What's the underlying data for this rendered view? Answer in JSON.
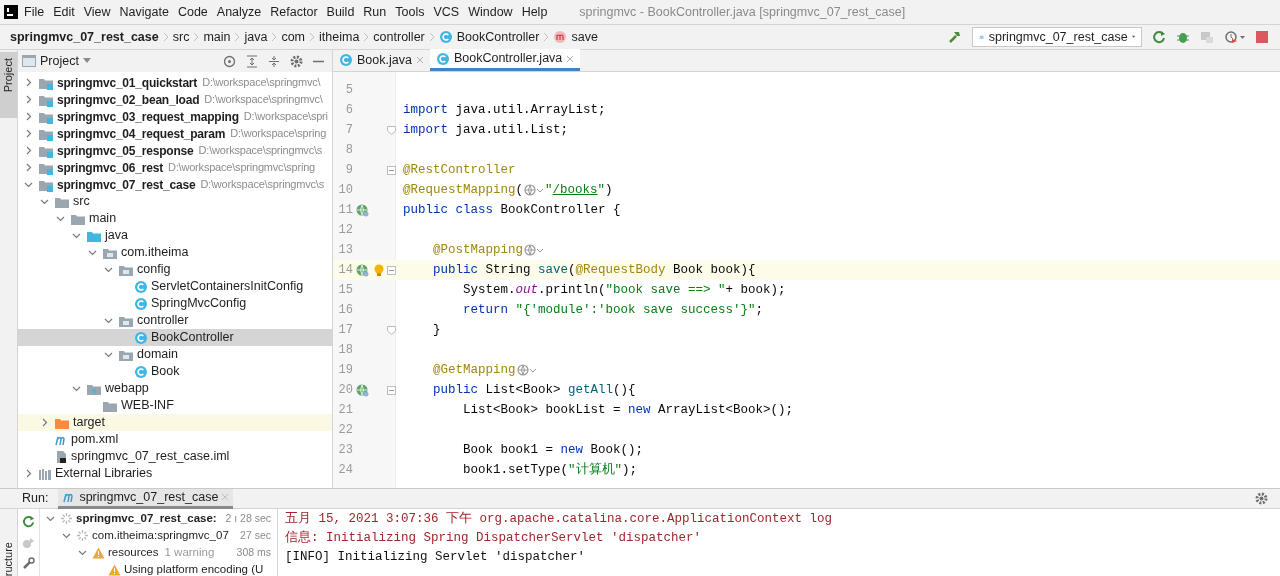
{
  "window": {
    "title": "springmvc - BookController.java [springmvc_07_rest_case]"
  },
  "menu": [
    "File",
    "Edit",
    "View",
    "Navigate",
    "Code",
    "Analyze",
    "Refactor",
    "Build",
    "Run",
    "Tools",
    "VCS",
    "Window",
    "Help"
  ],
  "breadcrumbs": [
    {
      "label": "springmvc_07_rest_case",
      "kind": "project"
    },
    {
      "label": "src",
      "kind": "folder"
    },
    {
      "label": "main",
      "kind": "folder"
    },
    {
      "label": "java",
      "kind": "folder"
    },
    {
      "label": "com",
      "kind": "folder"
    },
    {
      "label": "itheima",
      "kind": "folder"
    },
    {
      "label": "controller",
      "kind": "folder"
    },
    {
      "label": "BookController",
      "kind": "class"
    },
    {
      "label": "save",
      "kind": "method"
    }
  ],
  "run_config": {
    "label": "springmvc_07_rest_case"
  },
  "side_tabs": [
    {
      "label": "Project",
      "selected": true
    },
    {
      "label": "ructure",
      "selected": false
    }
  ],
  "project": {
    "title": "Project",
    "tree": [
      {
        "name": "springmvc_01_quickstart",
        "path": "D:\\workspace\\springmvc\\",
        "kind": "module",
        "expanded": false,
        "selected": false
      },
      {
        "name": "springmvc_02_bean_load",
        "path": "D:\\workspace\\springmvc\\",
        "kind": "module",
        "expanded": false,
        "selected": false
      },
      {
        "name": "springmvc_03_request_mapping",
        "path": "D:\\workspace\\spri",
        "kind": "module",
        "expanded": false,
        "selected": false
      },
      {
        "name": "springmvc_04_request_param",
        "path": "D:\\workspace\\spring",
        "kind": "module",
        "expanded": false,
        "selected": false
      },
      {
        "name": "springmvc_05_response",
        "path": "D:\\workspace\\springmvc\\s",
        "kind": "module",
        "expanded": false,
        "selected": false
      },
      {
        "name": "springmvc_06_rest",
        "path": "D:\\workspace\\springmvc\\spring",
        "kind": "module",
        "expanded": false,
        "selected": false
      },
      {
        "name": "springmvc_07_rest_case",
        "path": "D:\\workspace\\springmvc\\s",
        "kind": "module",
        "expanded": true,
        "selected": false,
        "children": [
          {
            "name": "src",
            "kind": "folder",
            "expanded": true,
            "selected": false,
            "children": [
              {
                "name": "main",
                "kind": "folder",
                "expanded": true,
                "selected": false,
                "children": [
                  {
                    "name": "java",
                    "kind": "source_folder",
                    "expanded": true,
                    "selected": false,
                    "children": [
                      {
                        "name": "com.itheima",
                        "kind": "package",
                        "expanded": true,
                        "selected": false,
                        "children": [
                          {
                            "name": "config",
                            "kind": "package",
                            "expanded": true,
                            "selected": false,
                            "children": [
                              {
                                "name": "ServletContainersInitConfig",
                                "kind": "class",
                                "selected": false
                              },
                              {
                                "name": "SpringMvcConfig",
                                "kind": "class",
                                "selected": false
                              }
                            ]
                          },
                          {
                            "name": "controller",
                            "kind": "package",
                            "expanded": true,
                            "selected": false,
                            "children": [
                              {
                                "name": "BookController",
                                "kind": "class",
                                "selected": true
                              }
                            ]
                          },
                          {
                            "name": "domain",
                            "kind": "package",
                            "expanded": true,
                            "selected": false,
                            "children": [
                              {
                                "name": "Book",
                                "kind": "class",
                                "selected": false
                              }
                            ]
                          }
                        ]
                      }
                    ]
                  },
                  {
                    "name": "webapp",
                    "kind": "web_folder",
                    "expanded": true,
                    "selected": false,
                    "children": [
                      {
                        "name": "WEB-INF",
                        "kind": "folder",
                        "selected": false
                      }
                    ]
                  }
                ]
              }
            ]
          },
          {
            "name": "target",
            "kind": "excluded_folder",
            "expanded": false,
            "selected": false
          },
          {
            "name": "pom.xml",
            "kind": "maven",
            "selected": false
          },
          {
            "name": "springmvc_07_rest_case.iml",
            "kind": "iml",
            "selected": false
          }
        ]
      },
      {
        "name": "External Libraries",
        "kind": "libraries",
        "expanded": false,
        "selected": false
      }
    ]
  },
  "editor_tabs": [
    {
      "label": "Book.java",
      "selected": false
    },
    {
      "label": "BookController.java",
      "selected": true
    }
  ],
  "code": [
    {
      "number": "5",
      "current": false
    },
    {
      "number": "6",
      "current": false,
      "tokens": [
        {
          "text": "import ",
          "kind": "keyword"
        },
        {
          "text": "java.util.ArrayList;",
          "kind": "plain"
        }
      ]
    },
    {
      "number": "7",
      "current": false,
      "fold_end": true,
      "tokens": [
        {
          "text": "import ",
          "kind": "keyword"
        },
        {
          "text": "java.util.List;",
          "kind": "plain"
        }
      ]
    },
    {
      "number": "8",
      "current": false
    },
    {
      "number": "9",
      "current": false,
      "fold_start": true,
      "tokens": [
        {
          "text": "@RestController",
          "kind": "annotation"
        }
      ]
    },
    {
      "number": "10",
      "current": false,
      "tokens": [
        {
          "text": "@RequestMapping",
          "kind": "annotation"
        },
        {
          "text": "(",
          "kind": "plain"
        },
        {
          "kind": "web_icon"
        },
        {
          "text": "\"",
          "kind": "string"
        },
        {
          "text": "/books",
          "kind": "url"
        },
        {
          "text": "\"",
          "kind": "string"
        },
        {
          "text": ")",
          "kind": "plain"
        }
      ]
    },
    {
      "number": "11",
      "current": false,
      "endpoint": true,
      "tokens": [
        {
          "text": "public class ",
          "kind": "keyword"
        },
        {
          "text": "BookController {",
          "kind": "plain"
        }
      ]
    },
    {
      "number": "12",
      "current": false
    },
    {
      "number": "13",
      "current": false,
      "tokens": [
        {
          "text": "    @PostMapping",
          "kind": "annotation"
        },
        {
          "kind": "web_icon"
        }
      ]
    },
    {
      "number": "14",
      "current": true,
      "endpoint": true,
      "bulb": true,
      "fold_start": true,
      "tokens": [
        {
          "text": "    public ",
          "kind": "keyword"
        },
        {
          "text": "String ",
          "kind": "plain"
        },
        {
          "text": "save",
          "kind": "method"
        },
        {
          "text": "(",
          "kind": "plain"
        },
        {
          "text": "@RequestBody",
          "kind": "annotation"
        },
        {
          "text": " Book book){",
          "kind": "plain"
        }
      ]
    },
    {
      "number": "15",
      "current": false,
      "tokens": [
        {
          "text": "        System.",
          "kind": "plain"
        },
        {
          "text": "out",
          "kind": "static"
        },
        {
          "text": ".println(",
          "kind": "plain"
        },
        {
          "text": "\"book save ==> \"",
          "kind": "string"
        },
        {
          "text": "+ book);",
          "kind": "plain"
        }
      ]
    },
    {
      "number": "16",
      "current": false,
      "tokens": [
        {
          "text": "        return ",
          "kind": "keyword"
        },
        {
          "text": "\"{'module':'book save success'}\"",
          "kind": "string"
        },
        {
          "text": ";",
          "kind": "plain"
        }
      ]
    },
    {
      "number": "17",
      "current": false,
      "fold_end": true,
      "tokens": [
        {
          "text": "    }",
          "kind": "plain"
        }
      ]
    },
    {
      "number": "18",
      "current": false
    },
    {
      "number": "19",
      "current": false,
      "tokens": [
        {
          "text": "    @GetMapping",
          "kind": "annotation"
        },
        {
          "kind": "web_icon"
        }
      ]
    },
    {
      "number": "20",
      "current": false,
      "endpoint": true,
      "fold_start": true,
      "tokens": [
        {
          "text": "    public ",
          "kind": "keyword"
        },
        {
          "text": "List<Book> ",
          "kind": "plain"
        },
        {
          "text": "getAll",
          "kind": "method"
        },
        {
          "text": "(){",
          "kind": "plain"
        }
      ]
    },
    {
      "number": "21",
      "current": false,
      "tokens": [
        {
          "text": "        List<Book> bookList = ",
          "kind": "plain"
        },
        {
          "text": "new ",
          "kind": "keyword"
        },
        {
          "text": "ArrayList<Book>();",
          "kind": "plain"
        }
      ]
    },
    {
      "number": "22",
      "current": false
    },
    {
      "number": "23",
      "current": false,
      "tokens": [
        {
          "text": "        Book book1 = ",
          "kind": "plain"
        },
        {
          "text": "new ",
          "kind": "keyword"
        },
        {
          "text": "Book();",
          "kind": "plain"
        }
      ]
    },
    {
      "number": "24",
      "current": false,
      "tokens": [
        {
          "text": "        book1.setType(",
          "kind": "plain"
        },
        {
          "text": "\"计算机\"",
          "kind": "string"
        },
        {
          "text": ");",
          "kind": "plain"
        }
      ]
    }
  ],
  "run_panel": {
    "label": "Run:",
    "tab": "springmvc_07_rest_case",
    "tree": [
      {
        "name": "springmvc_07_rest_case:",
        "time": "2 ı 28 sec",
        "kind": "running",
        "expanded": true,
        "children": [
          {
            "name": "com.itheima:springmvc_07",
            "time": "27 sec",
            "kind": "running",
            "expanded": true,
            "children": [
              {
                "name": "resources",
                "note": "1 warning",
                "time": "308 ms",
                "kind": "warning",
                "expanded": true,
                "children": [
                  {
                    "name": "Using platform encoding (U",
                    "kind": "warning"
                  }
                ]
              }
            ]
          }
        ]
      }
    ],
    "console": [
      {
        "text": "五月 15, 2021 3:07:36 下午 org.apache.catalina.core.ApplicationContext log",
        "kind": "stderr"
      },
      {
        "text": "信息: Initializing Spring DispatcherServlet 'dispatcher'",
        "kind": "stderr"
      },
      {
        "text": "[INFO] Initializing Servlet 'dispatcher'",
        "kind": "stdout"
      }
    ]
  }
}
